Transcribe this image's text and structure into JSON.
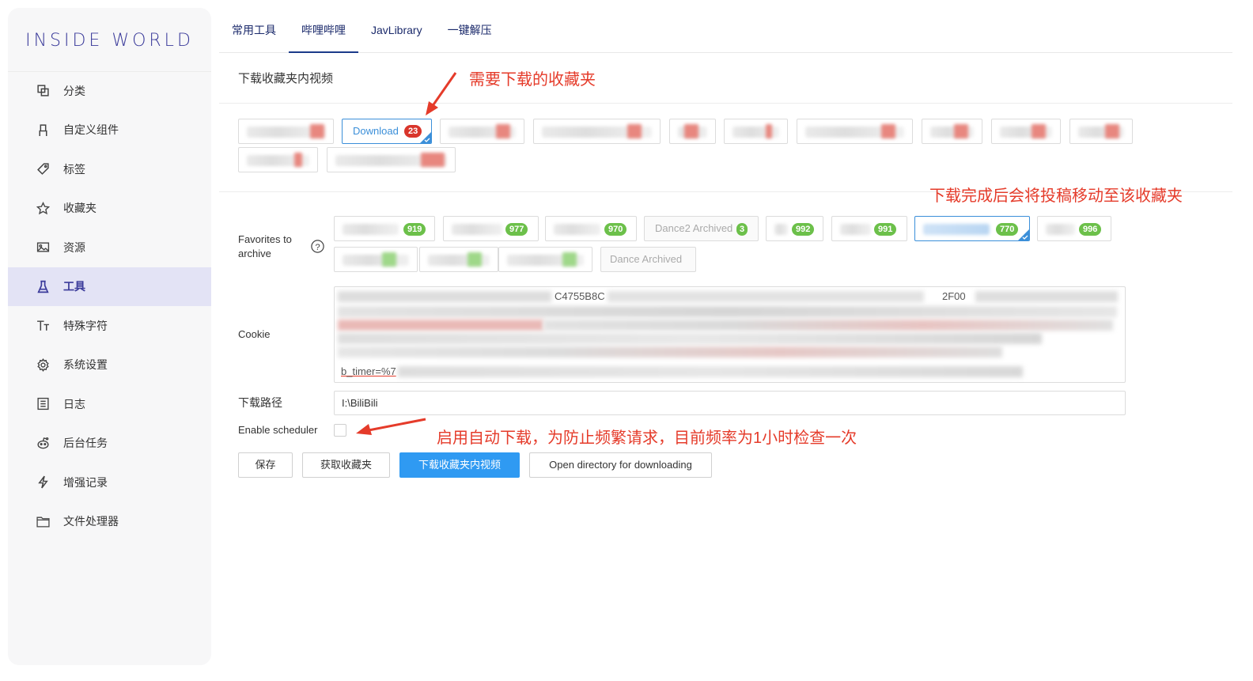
{
  "app": {
    "logo": "INSIDE WORLD"
  },
  "sidebar": {
    "items": [
      {
        "label": "分类",
        "icon": "category-icon"
      },
      {
        "label": "自定义组件",
        "icon": "component-icon"
      },
      {
        "label": "标签",
        "icon": "tag-icon"
      },
      {
        "label": "收藏夹",
        "icon": "star-icon"
      },
      {
        "label": "资源",
        "icon": "image-icon"
      },
      {
        "label": "工具",
        "icon": "flask-icon",
        "active": true
      },
      {
        "label": "特殊字符",
        "icon": "text-icon"
      },
      {
        "label": "系统设置",
        "icon": "gear-icon"
      },
      {
        "label": "日志",
        "icon": "log-icon"
      },
      {
        "label": "后台任务",
        "icon": "reddit-icon"
      },
      {
        "label": "增强记录",
        "icon": "lightning-icon"
      },
      {
        "label": "文件处理器",
        "icon": "folder-icon"
      }
    ]
  },
  "tabs": [
    "常用工具",
    "哔哩哔哩",
    "JavLibrary",
    "一键解压"
  ],
  "active_tab": "哔哩哔哩",
  "section": {
    "title": "下载收藏夹内视频"
  },
  "download_tag": {
    "label": "Download",
    "count": "23"
  },
  "archive": {
    "label": "Favorites to archive",
    "counts": [
      "919",
      "977",
      "970",
      "992",
      "991",
      "770",
      "996"
    ],
    "dance2": {
      "label": "Dance2 Archived",
      "count": "3"
    },
    "dance_archived": "Dance Archived"
  },
  "cookie": {
    "label": "Cookie",
    "fragment1": "C4755B8C",
    "fragment2": "2F00",
    "fragment3": "b_timer=%7"
  },
  "path": {
    "label": "下载路径",
    "value": "I:\\BiliBili"
  },
  "scheduler": {
    "label": "Enable scheduler"
  },
  "buttons": {
    "save": "保存",
    "fetch": "获取收藏夹",
    "download": "下载收藏夹内视频",
    "open_dir": "Open directory for downloading"
  },
  "annotations": {
    "need_download": "需要下载的收藏夹",
    "move_after": "下载完成后会将投稿移动至该收藏夹",
    "auto_download": "启用自动下载，为防止频繁请求，目前频率为1小时检查一次"
  },
  "colors": {
    "accent": "#3a3a9a",
    "primary": "#2f9af2",
    "annotation": "#e53b2a",
    "badge_green": "#6cc04a",
    "badge_red": "#d9352b"
  }
}
